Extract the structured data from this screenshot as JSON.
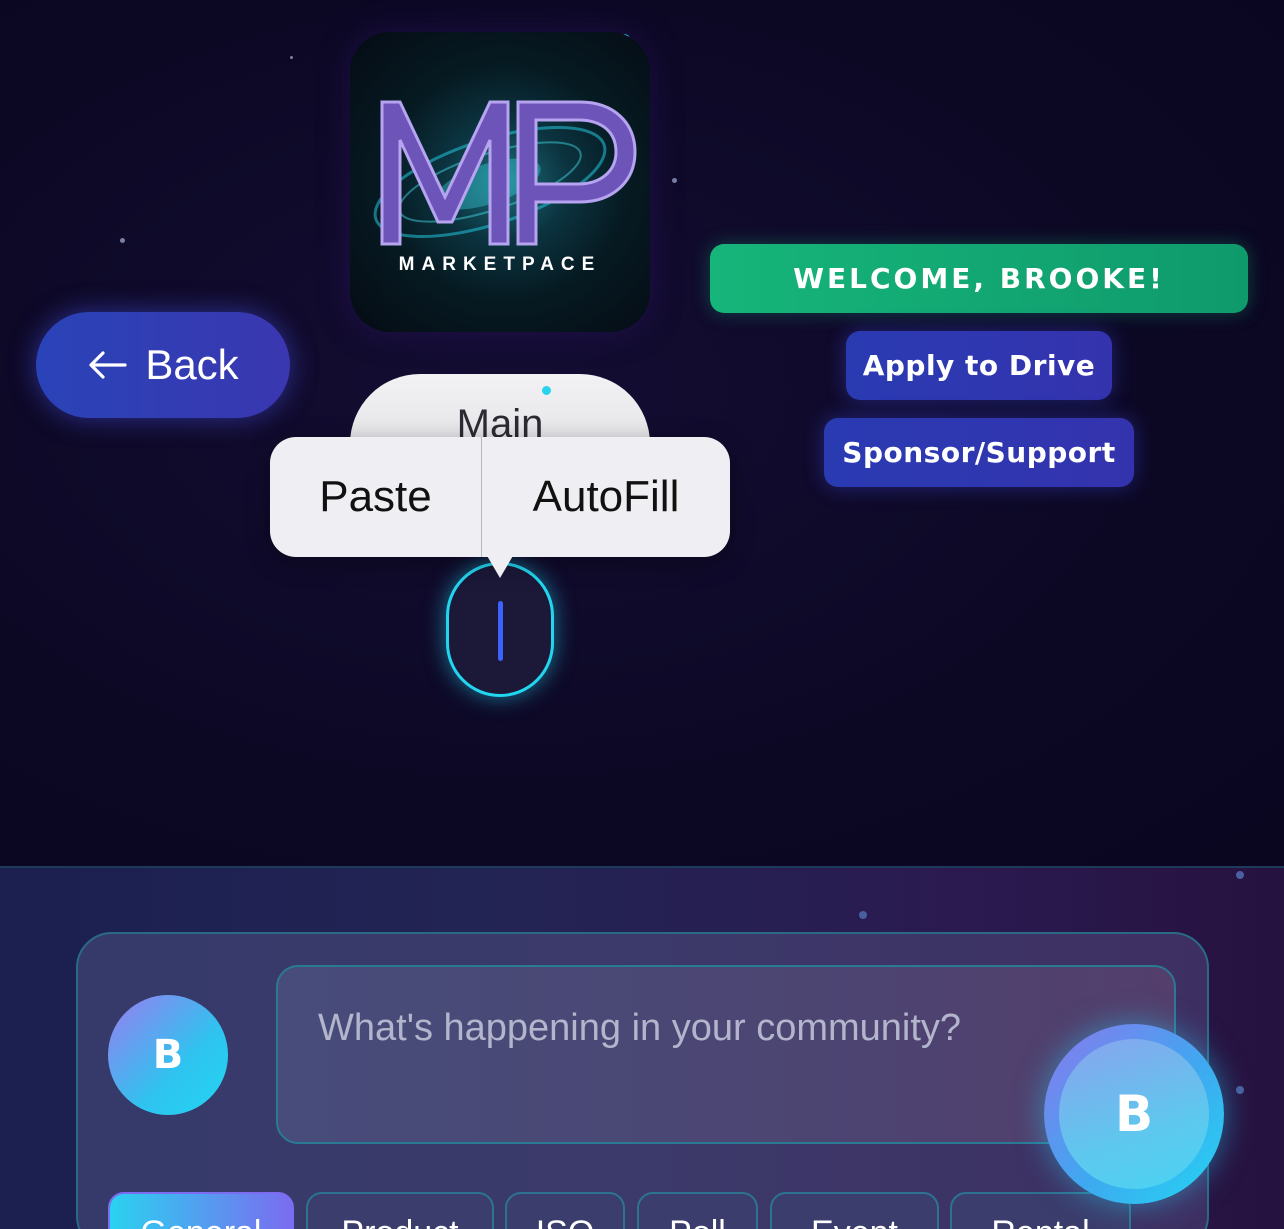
{
  "header": {
    "logo_text": "MARKETPACE",
    "back_label": "Back",
    "welcome_label": "WELCOME, BROOKE!",
    "apply_label": "Apply to Drive",
    "sponsor_label": "Sponsor/Support"
  },
  "main_tab": {
    "label": "Main"
  },
  "edit_menu": {
    "items": [
      "Paste",
      "AutoFill"
    ]
  },
  "composer": {
    "avatar_initial": "B",
    "placeholder": "What's happening in your community?",
    "categories": [
      "General",
      "Product",
      "ISO",
      "Poll",
      "Event",
      "Rental"
    ],
    "active_category": "General"
  },
  "fab": {
    "initial": "B"
  },
  "colors": {
    "background": "#0c0824",
    "welcome_green": "#16b57a",
    "button_blue": "#2a3bb2",
    "accent_cyan": "#22d6ef"
  },
  "icons": [
    "arrow-left-icon",
    "text-caret-icon"
  ]
}
